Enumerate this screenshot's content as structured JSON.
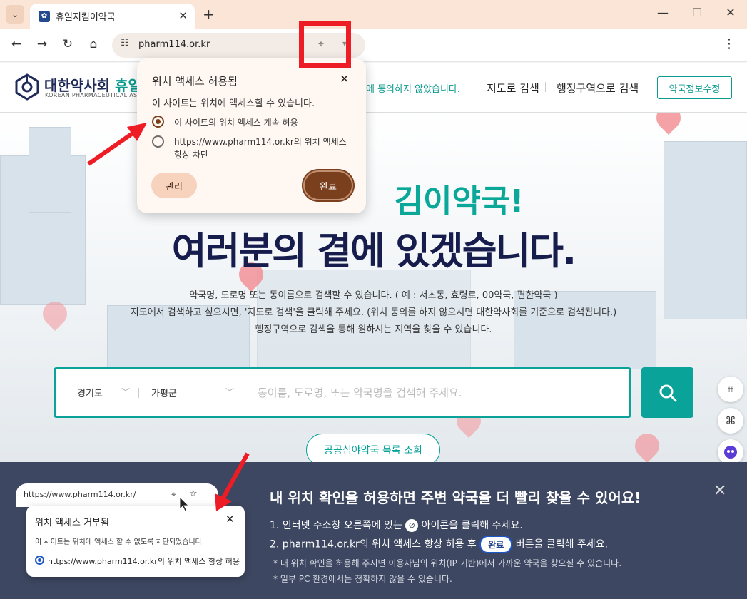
{
  "browser": {
    "tab_title": "휴일지킴이약국",
    "new_tab": "+",
    "url": "pharm114.or.kr",
    "window": {
      "minimize": "—",
      "maximize": "☐",
      "close": "✕"
    }
  },
  "site": {
    "logo_main": "대한약사회",
    "logo_accent": "휴일지",
    "logo_sub": "KOREAN PHARMACEUTICAL ASSO",
    "consent_note": "에 동의하지 않았습니다.",
    "nav": {
      "map": "지도로 검색",
      "region": "행정구역으로 검색"
    },
    "info_edit": "약국정보수정"
  },
  "hero": {
    "title1": "김이약국!",
    "title2": "여러분의 곁에 있겠습니다.",
    "desc_lines": [
      "약국명, 도로명 또는 동이름으로 검색할 수 있습니다. ( 예 : 서초동, 효령로, 00약국, 편한약국 )",
      "지도에서 검색하고 싶으시면, '지도로 검색'을 클릭해 주세요. (위치 동의를 하지 않으시면 대한약사회를 기준으로 검색됩니다.)",
      "행정구역으로 검색을 통해 원하시는 지역을 찾을 수 있습니다."
    ]
  },
  "search": {
    "province": "경기도",
    "county": "가평군",
    "placeholder": "동이름, 도로명, 또는 약국명을 검색해 주세요."
  },
  "public_button": "공공심야약국 목록 조회",
  "location_popup": {
    "title": "위치 액세스 허용됨",
    "close": "✕",
    "desc": "이 사이트는 위치에 액세스할 수 있습니다.",
    "option_allow": "이 사이트의 위치 액세스 계속 허용",
    "option_block": "https://www.pharm114.or.kr의 위치 액세스 항상 차단",
    "manage": "관리",
    "done": "완료"
  },
  "banner": {
    "title": "내 위치 확인을 허용하면 주변 약국을 더 빨리 찾을 수 있어요!",
    "step1_before": "1. 인터넷 주소창 오른쪽에 있는",
    "step1_after": "아이콘을 클릭해 주세요.",
    "step2_before": "2. pharm114.or.kr의 위치 액세스 항상 허용 후",
    "step2_pill": "완료",
    "step2_after": "버튼을 클릭해 주세요.",
    "note1": "* 내 위치 확인을 허용해 주시면 이용자님의 위치(IP 기반)에서 가까운 약국을 찾으실 수 있습니다.",
    "note2": "* 일부 PC 환경에서는 정확하지 않을 수 있습니다.",
    "mini_url": "https://www.pharm114.or.kr/",
    "mini_title": "위치 액세스 거부됨",
    "mini_desc": "이 사이트는 위치에 액세스 할 수 없도록 차단되었습니다.",
    "mini_option": "https://www.pharm114.or.kr의 위치 액세스 항상 허용"
  },
  "colors": {
    "teal": "#0aa39a",
    "navy": "#161d4d",
    "brown": "#7a3f1d",
    "red": "#ee1c24",
    "banner": "#3d4761"
  }
}
